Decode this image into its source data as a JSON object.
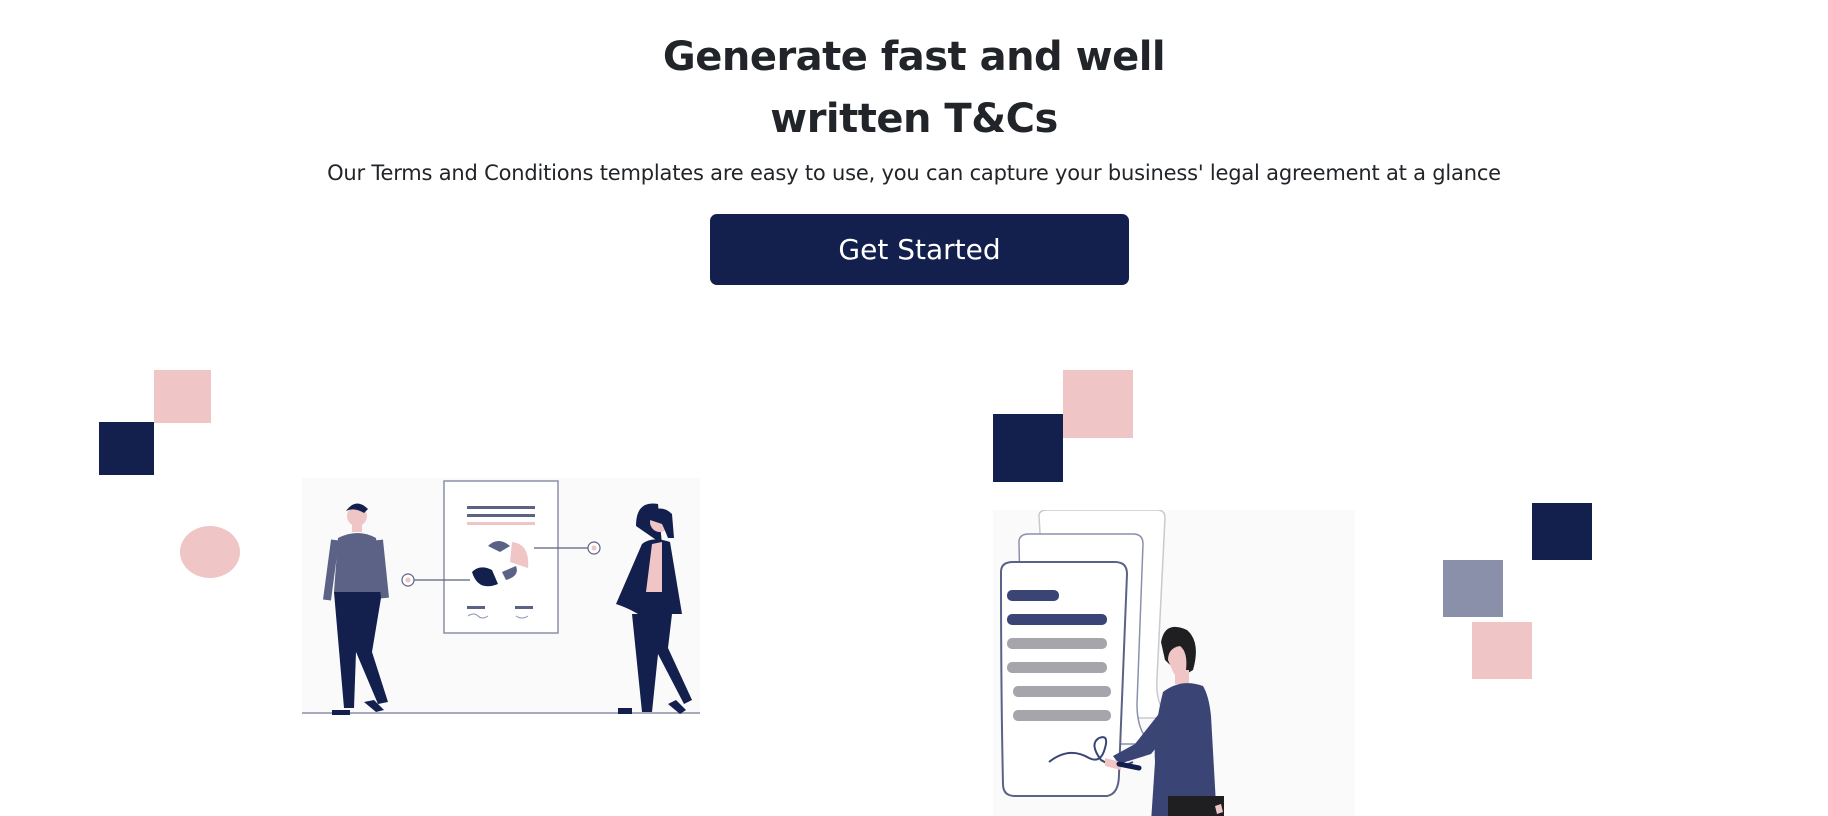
{
  "hero": {
    "title_line1": "Generate fast and well",
    "title_line2": "written T&Cs",
    "subtitle": "Our Terms and Conditions templates are easy to use, you can capture your business' legal agreement at a glance",
    "cta_label": "Get Started"
  },
  "colors": {
    "navy": "#131f4d",
    "pink": "#efc5c6",
    "slate": "#8b90aa",
    "text": "#212529"
  },
  "illustrations": [
    {
      "name": "two-people-reviewing-document-illustration"
    },
    {
      "name": "man-signing-scroll-document-illustration"
    }
  ]
}
